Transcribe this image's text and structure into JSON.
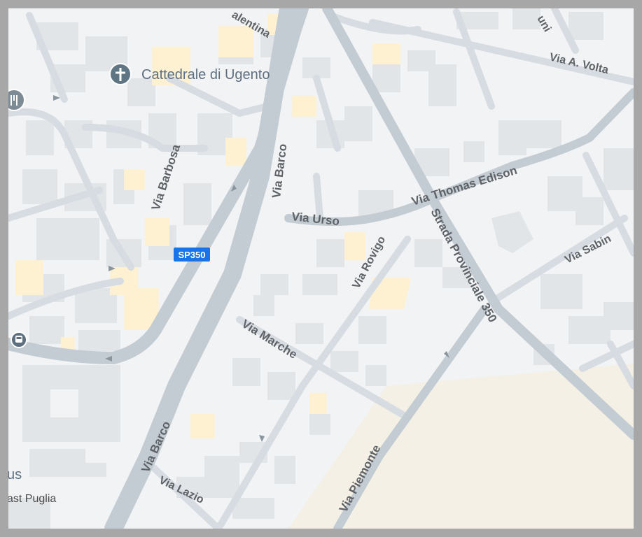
{
  "map": {
    "landmark": {
      "name": "Cattedrale di Ugento",
      "icon": "church-cross-icon"
    },
    "restaurant_icon": "restaurant-icon",
    "bus_icon": "bus-stop-icon",
    "route_badge": "SP350",
    "streets": {
      "valentina": "alentina",
      "volta": "Via A. Volta",
      "uni": "uni",
      "barbosa": "Via Barbosa",
      "barco_top": "Via Barco",
      "barco_bottom": "Via Barco",
      "thomas_edison": "Via Thomas Edison",
      "urso": "Via Urso",
      "rovigo": "Via Rovigo",
      "provinciale": "Strada Provinciale 350",
      "sabin": "Via Sabin",
      "marche": "Via Marche",
      "piemonte": "Via Piemonte",
      "lazio": "Via Lazio"
    },
    "edge_labels": {
      "us": "us",
      "east_puglia": "ast Puglia"
    },
    "colors": {
      "background": "#f1f3f4",
      "building": "#e2e5e8",
      "highlighted_building": "#fdf1d2",
      "minor_road": "#d6dce1",
      "major_road": "#c3cbd3",
      "park_area": "#f4f0e5",
      "route_badge_bg": "#1a73e8"
    }
  }
}
